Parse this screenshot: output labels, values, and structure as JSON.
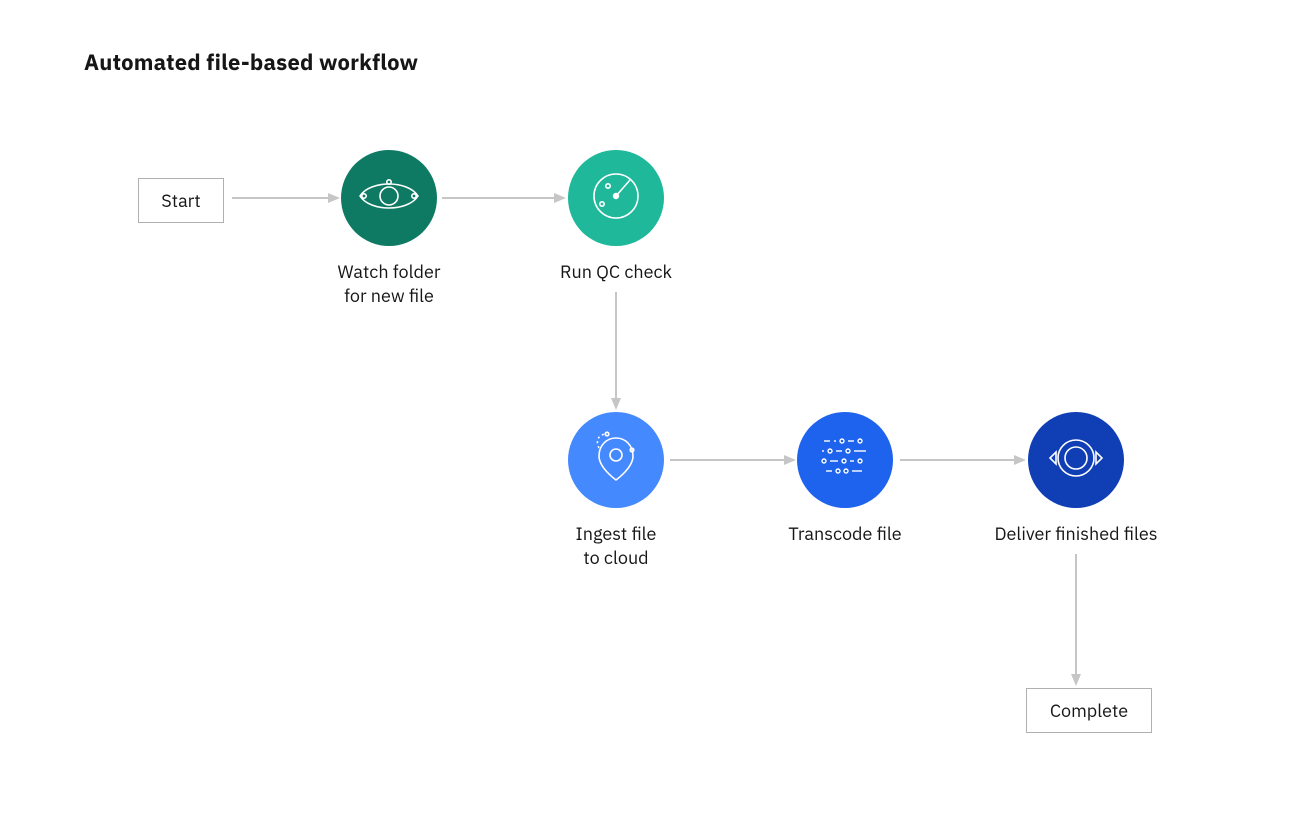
{
  "title": "Automated file-based workflow",
  "start_label": "Start",
  "complete_label": "Complete",
  "nodes": {
    "watch": {
      "label_l1": "Watch folder",
      "label_l2": "for new file",
      "color": "#0f7a63"
    },
    "qc": {
      "label_l1": "Run QC check",
      "label_l2": "",
      "color": "#1fb89a"
    },
    "ingest": {
      "label_l1": "Ingest file",
      "label_l2": "to cloud",
      "color": "#4589ff"
    },
    "transcode": {
      "label_l1": "Transcode file",
      "label_l2": "",
      "color": "#1d63ed"
    },
    "deliver": {
      "label_l1": "Deliver finished files",
      "label_l2": "",
      "color": "#0f3eb5"
    }
  }
}
